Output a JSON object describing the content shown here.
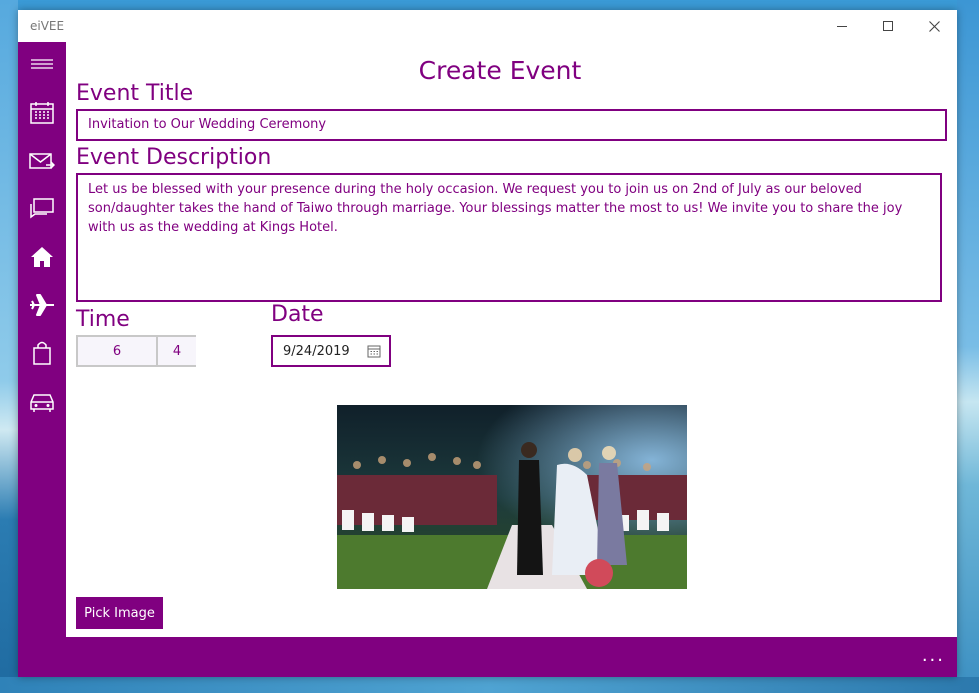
{
  "window": {
    "app_title": "eiVEE"
  },
  "sidebar": {
    "items": [
      {
        "icon": "hamburger-icon"
      },
      {
        "icon": "calendar-icon"
      },
      {
        "icon": "mail-icon"
      },
      {
        "icon": "chat-icon"
      },
      {
        "icon": "home-icon"
      },
      {
        "icon": "airplane-icon"
      },
      {
        "icon": "shopping-bag-icon"
      },
      {
        "icon": "car-icon"
      }
    ]
  },
  "page": {
    "title": "Create Event",
    "event_title_label": "Event Title",
    "event_title_value": "Invitation to Our Wedding Ceremony",
    "event_description_label": "Event Description",
    "event_description_value": "Let us be blessed with your presence during the holy occasion. We request you to join us on 2nd of July as our beloved son/daughter takes the hand of Taiwo through marriage. Your blessings matter the most to us! We invite you to share the joy with us as the wedding at Kings Hotel.",
    "time_label": "Time",
    "time_hour": "6",
    "time_minute": "4",
    "date_label": "Date",
    "date_value": "9/24/2019",
    "pick_image_label": "Pick Image"
  },
  "bottombar": {
    "more_label": "..."
  },
  "colors": {
    "accent": "#800080"
  }
}
